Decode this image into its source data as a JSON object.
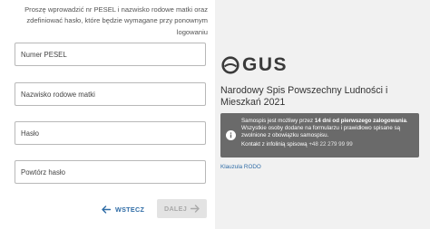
{
  "form": {
    "instructions": "Proszę wprowadzić nr PESEL i nazwisko rodowe matki oraz zdefiniować hasło, które będzie wymagane przy ponownym logowaniu",
    "fields": {
      "pesel": {
        "value": "",
        "placeholder": "Numer PESEL"
      },
      "mother_surname": {
        "value": "",
        "placeholder": "Nazwisko rodowe matki"
      },
      "password": {
        "value": "",
        "placeholder": "Hasło"
      },
      "password_repeat": {
        "value": "",
        "placeholder": "Powtórz hasło"
      }
    },
    "back_label": "WSTECZ",
    "next_label": "DALEJ",
    "next_enabled": false
  },
  "brand": {
    "logo_text": "GUS",
    "title": "Narodowy Spis Powszechny Ludności i Mieszkań 2021"
  },
  "info": {
    "icon": "info-icon",
    "pre": "Samospis jest możliwy przez ",
    "bold": "14 dni od pierwszego zalogowania",
    "post": ". Wszystkie osoby dodane na formularzu i prawidłowo spisane są zwolnione z obowiązku samospisu.",
    "contact_label": "Kontakt z infolinią spisową",
    "contact_phone": "+48 22 279 99 99"
  },
  "rodo_link": "Klauzula RODO",
  "colors": {
    "accent": "#2f6ca6",
    "info_bg": "#6a6a6a",
    "panel_bg": "#f1f1f1",
    "disabled_button_bg": "#e3e3e3"
  }
}
